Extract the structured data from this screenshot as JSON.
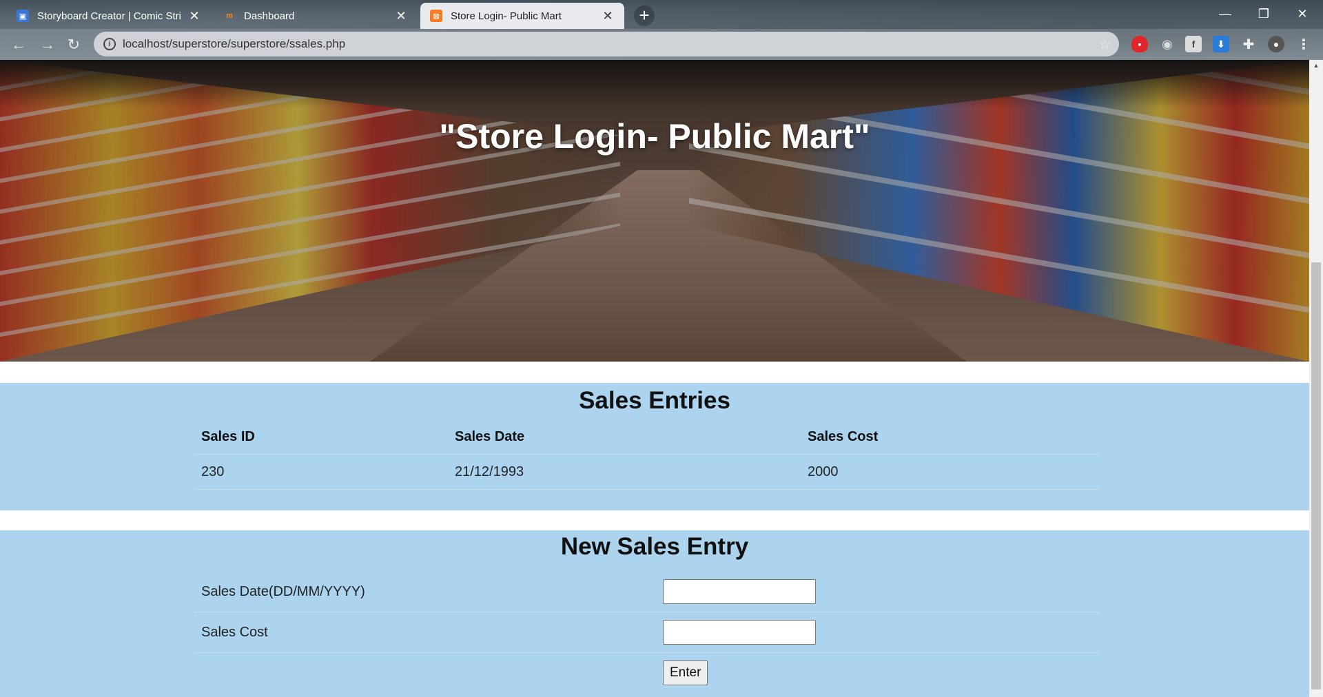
{
  "browser": {
    "tabs": [
      {
        "title": "Storyboard Creator | Comic Strip",
        "favicon": "storyboard-icon",
        "active": false
      },
      {
        "title": "Dashboard",
        "favicon": "moodle-icon",
        "active": false
      },
      {
        "title": "Store Login- Public Mart",
        "favicon": "xampp-icon",
        "active": true
      }
    ],
    "new_tab_label": "+",
    "url": "localhost/superstore/superstore/ssales.php"
  },
  "page": {
    "hero_title": "\"Store Login- Public Mart\"",
    "sales_entries": {
      "heading": "Sales Entries",
      "columns": [
        "Sales ID",
        "Sales Date",
        "Sales Cost"
      ],
      "rows": [
        {
          "id": "230",
          "date": "21/12/1993",
          "cost": "2000"
        }
      ]
    },
    "new_entry": {
      "heading": "New Sales Entry",
      "fields": [
        {
          "label": "Sales Date(DD/MM/YYYY)",
          "value": ""
        },
        {
          "label": "Sales Cost",
          "value": ""
        }
      ],
      "submit_label": "Enter"
    }
  },
  "colors": {
    "band_bg": "#add4ef",
    "active_tab_bg": "#e8eaed"
  }
}
